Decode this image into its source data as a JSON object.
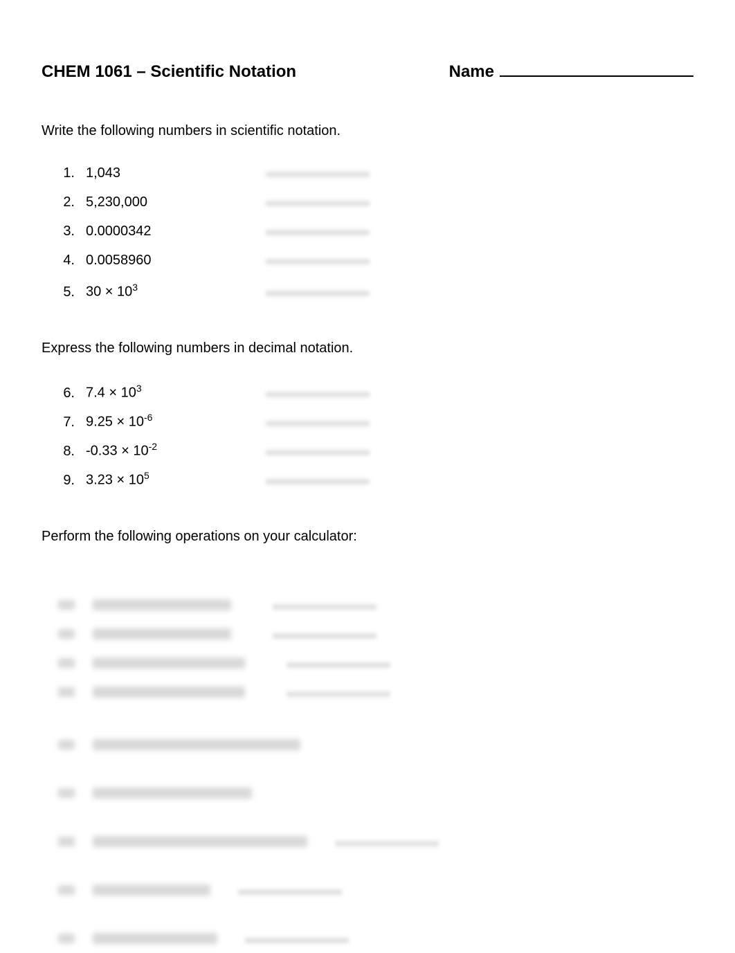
{
  "header": {
    "title": "CHEM 1061 – Scientific Notation",
    "name_label": "Name"
  },
  "section1": {
    "instruction": "Write the following numbers in scientific notation.",
    "items": [
      {
        "num": "1.",
        "content_html": "1,043"
      },
      {
        "num": "2.",
        "content_html": "5,230,000"
      },
      {
        "num": "3.",
        "content_html": "0.0000342"
      },
      {
        "num": "4.",
        "content_html": "0.0058960"
      },
      {
        "num": "5.",
        "content_html": "30 × 10<sup>3</sup>"
      }
    ]
  },
  "section2": {
    "instruction": "Express the following numbers in decimal notation.",
    "items": [
      {
        "num": "6.",
        "content_html": "7.4 × 10<sup>3</sup>"
      },
      {
        "num": "7.",
        "content_html": "9.25 × 10<sup>-6</sup>"
      },
      {
        "num": "8.",
        "content_html": "-0.33 × 10<sup>-2</sup>"
      },
      {
        "num": "9.",
        "content_html": "3.23 × 10<sup>5</sup>"
      }
    ]
  },
  "section3": {
    "instruction": "Perform the following operations on your calculator:",
    "blur_rows": [
      {
        "content_w": 200,
        "ans": true
      },
      {
        "content_w": 200,
        "ans": true
      },
      {
        "content_w": 220,
        "ans": true
      },
      {
        "content_w": 220,
        "ans": true
      }
    ],
    "blur_lone": [
      {
        "content_w": 300,
        "ans": false,
        "gap": true
      },
      {
        "content_w": 230,
        "ans": false,
        "gap": true
      },
      {
        "content_w": 310,
        "ans": true,
        "gap": true,
        "ans_ml": 40
      },
      {
        "content_w": 170,
        "ans": true,
        "gap": true,
        "ans_ml": 40
      },
      {
        "content_w": 180,
        "ans": true,
        "gap": true,
        "ans_ml": 40
      }
    ]
  }
}
